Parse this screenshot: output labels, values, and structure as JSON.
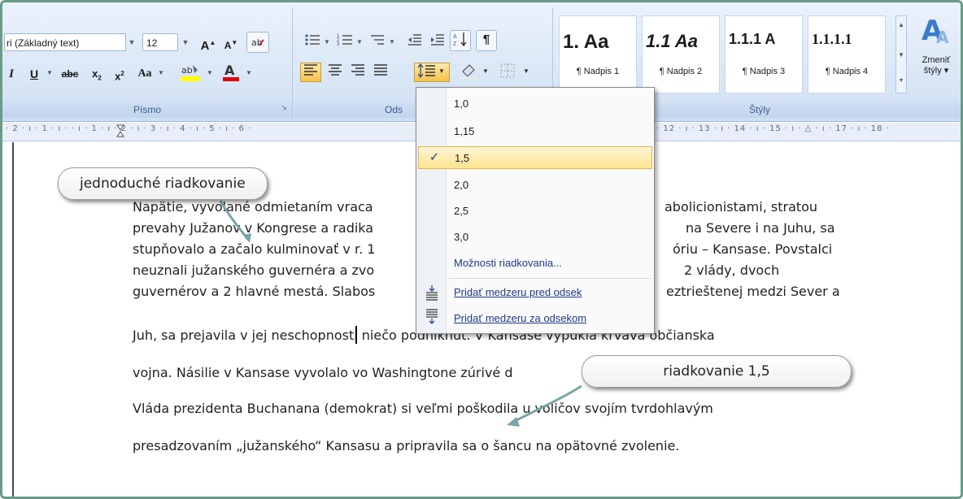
{
  "ribbon": {
    "font_group": {
      "font_name": "ri (Základný text)",
      "font_size": "12",
      "label": "Písmo"
    },
    "paragraph_group": {
      "label": "Ods"
    },
    "styles_group": {
      "label": "Štýly",
      "tiles": [
        {
          "preview": "1. Aa",
          "name": "¶ Nadpis 1"
        },
        {
          "preview": "1.1 Aa",
          "name": "¶ Nadpis 2"
        },
        {
          "preview": "1.1.1 A",
          "name": "¶ Nadpis 3"
        },
        {
          "preview": "1.1.1.1",
          "name": "¶ Nadpis 4"
        }
      ],
      "change_styles_label": "Zmeniť",
      "change_styles_label2": "štýly ▾"
    }
  },
  "ruler": {
    "left_text": "· 2 · ı · 1 · ı ·   · ı · 1 · ı · 2 · ı · 3 · ı · 4 · ı · 5 · ı · 6 ·",
    "right_text": "· 12 · ı · 13 · ı · 14 · ı · 15 · ı · △ · ı · 17 · ı · 18 ·"
  },
  "line_spacing_menu": {
    "items": [
      {
        "label": "1,0",
        "selected": false
      },
      {
        "label": "1,15",
        "selected": false
      },
      {
        "label": "1,5",
        "selected": true
      },
      {
        "label": "2,0",
        "selected": false
      },
      {
        "label": "2,5",
        "selected": false
      },
      {
        "label": "3,0",
        "selected": false
      }
    ],
    "options_label": "Možnosti riadkovania...",
    "add_before_label": "Pridať medzeru pred odsek",
    "add_after_label": "Pridať medzeru za odsekom",
    "check_glyph": "✓"
  },
  "callouts": {
    "single": "jednoduché riadkovanie",
    "onefive": "riadkovanie 1,5"
  },
  "document": {
    "lines": [
      {
        "left": "Napätie, vyvolané odmietaním vraca",
        "right": "abolicionistami, stratou"
      },
      {
        "left": "prevahy Južanov v Kongrese a radika",
        "right": "na Severe i na Juhu, sa"
      },
      {
        "left": "stupňovalo a začalo kulminovať v r. 1",
        "right": "óriu – Kansase. Povstalci"
      },
      {
        "left": "neuznali južanského guvernéra a zvo",
        "right": "2 vlády, dvoch"
      },
      {
        "left": "guvernérov a 2 hlavné mestá. Slabos",
        "right": "eztrieštenej medzi Sever a"
      },
      {
        "left": "Juh, sa prejavila v jej neschopnosti  niečo podniknúť. V Kansase vypukla krvavá občianska",
        "right": ""
      },
      {
        "left": "vojna. Násilie v Kansase vyvolalo vo Washingtone zúrivé d",
        "right": ""
      },
      {
        "left": "Vláda prezidenta Buchanana (demokrat) si veľmi poškodila  u voličov svojím tvrdohlavým",
        "right": ""
      },
      {
        "left": "presadzovaním „južanského“ Kansasu a pripravila sa o šancu na opätovné  zvolenie.",
        "right": ""
      }
    ]
  }
}
